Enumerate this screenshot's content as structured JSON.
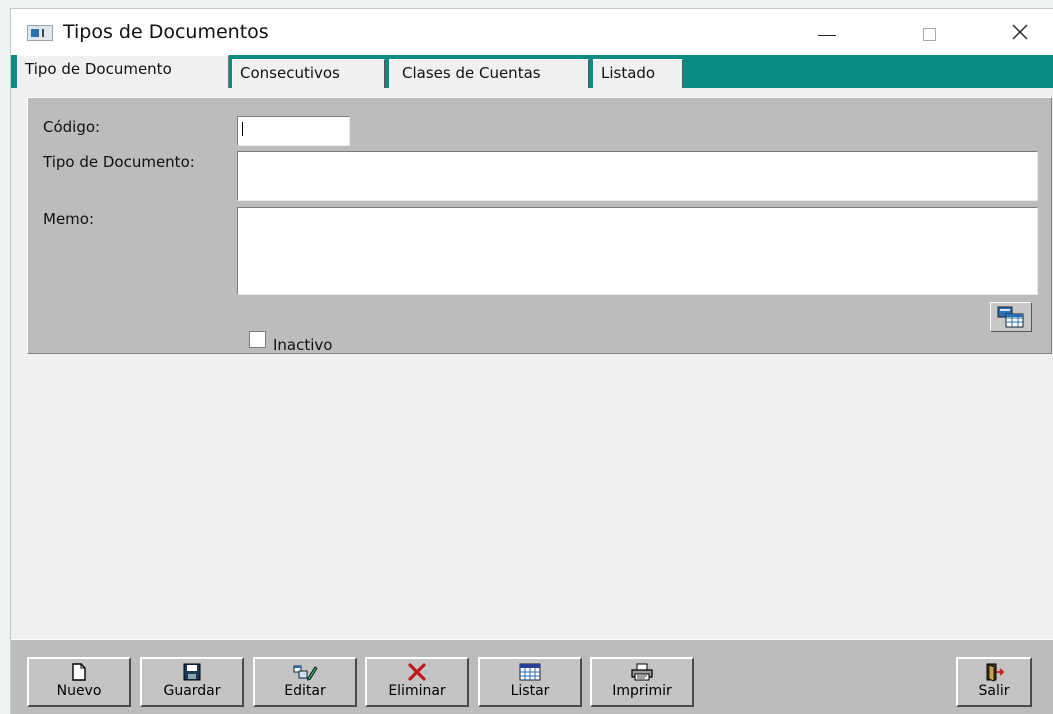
{
  "window": {
    "title": "Tipos de Documentos"
  },
  "tabs": [
    {
      "label": "Tipo de Documento",
      "active": true
    },
    {
      "label": "Consecutivos",
      "active": false
    },
    {
      "label": "Clases de Cuentas",
      "active": false
    },
    {
      "label": "Listado",
      "active": false
    }
  ],
  "form": {
    "codigo_label": "Código:",
    "codigo_value": "",
    "tipo_label": "Tipo de Documento:",
    "tipo_value": "",
    "memo_label": "Memo:",
    "memo_value": "",
    "inactivo_label": "Inactivo",
    "inactivo_checked": false
  },
  "toolbar": {
    "buttons": [
      {
        "label": "Nuevo",
        "icon": "new-document-icon"
      },
      {
        "label": "Guardar",
        "icon": "floppy-disk-icon"
      },
      {
        "label": "Editar",
        "icon": "edit-pencil-icon"
      },
      {
        "label": "Eliminar",
        "icon": "red-x-delete-icon"
      },
      {
        "label": "Listar",
        "icon": "calendar-list-icon"
      },
      {
        "label": "Imprimir",
        "icon": "printer-icon"
      },
      {
        "label": "Salir",
        "icon": "exit-door-icon"
      }
    ]
  },
  "colors": {
    "tabstrip": "#0c8a84",
    "panel": "#bcbcbc",
    "delete_icon": "#c0191f"
  }
}
